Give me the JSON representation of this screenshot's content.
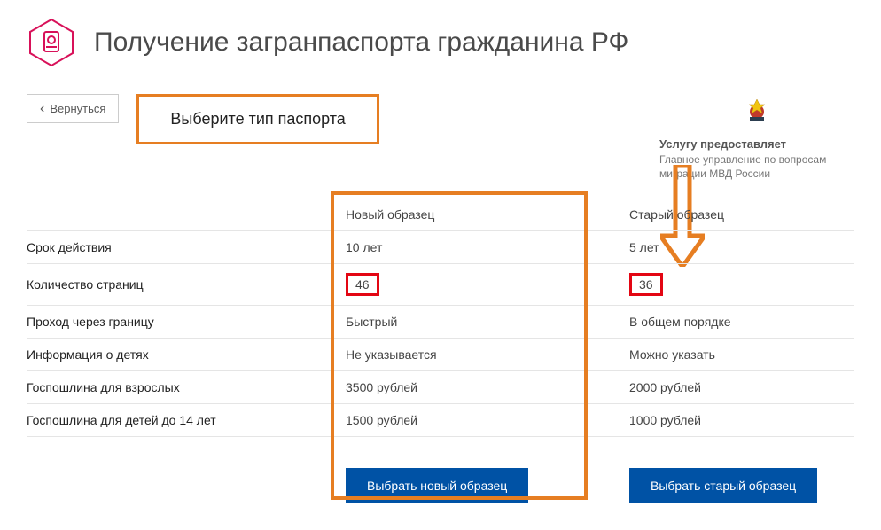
{
  "page": {
    "title": "Получение загранпаспорта гражданина РФ",
    "back_label": "Вернуться",
    "choose_label": "Выберите тип паспорта"
  },
  "provider": {
    "heading": "Услугу предоставляет",
    "name": "Главное управление по вопросам миграции МВД России"
  },
  "columns": {
    "new_header": "Новый образец",
    "old_header": "Старый образец"
  },
  "rows": {
    "validity": {
      "label": "Срок действия",
      "new": "10 лет",
      "old": "5 лет"
    },
    "pages": {
      "label": "Количество страниц",
      "new": "46",
      "old": "36"
    },
    "border": {
      "label": "Проход через границу",
      "new": "Быстрый",
      "old": "В общем порядке"
    },
    "children": {
      "label": "Информация о детях",
      "new": "Не указывается",
      "old": "Можно указать"
    },
    "fee_adult": {
      "label": "Госпошлина для взрослых",
      "new": "3500 рублей",
      "old": "2000 рублей"
    },
    "fee_child": {
      "label": "Госпошлина для детей до 14 лет",
      "new": "1500 рублей",
      "old": "1000 рублей"
    }
  },
  "buttons": {
    "choose_new": "Выбрать новый образец",
    "choose_old": "Выбрать старый образец"
  }
}
